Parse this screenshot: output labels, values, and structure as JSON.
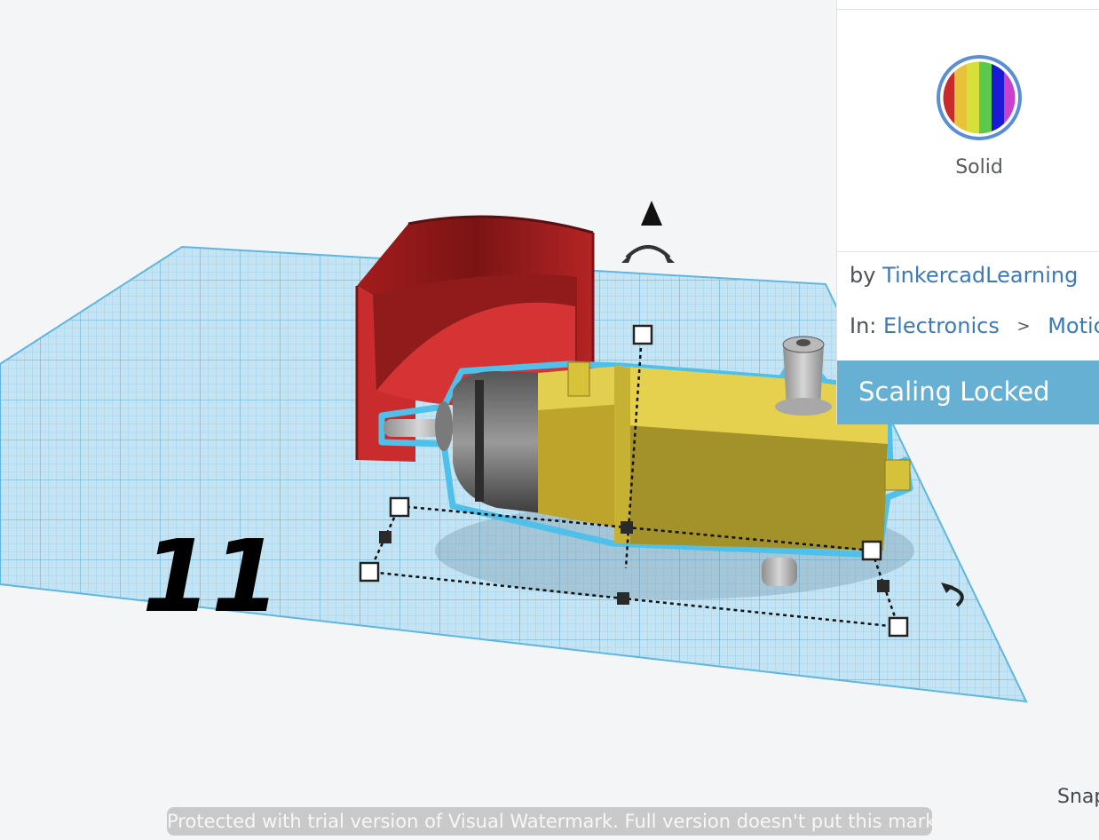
{
  "panel": {
    "material": {
      "label": "Solid",
      "swatch_colors": [
        "#c92a2a",
        "#e8c33a",
        "#d7e03a",
        "#5bc94b",
        "#1a1ad6",
        "#c940c9"
      ],
      "ring_color": "#5a8fd6"
    },
    "author": {
      "prefix": "by",
      "name": "TinkercadLearning"
    },
    "category": {
      "prefix": "In:",
      "items": [
        "Electronics",
        "Motic"
      ],
      "separator": ">"
    },
    "scaling_locked": "Scaling Locked"
  },
  "workspace": {
    "snap_label": "Snap",
    "icons": [
      "view-cube-arrow-icon",
      "rotate-arrow-icon",
      "rotate-handle-icon"
    ],
    "shape_number_label": "11"
  },
  "watermark": "Protected with trial version of Visual Watermark. Full version doesn't put this mark.",
  "colors": {
    "grid": "#8ccbea",
    "motor_body": "#d9c43b",
    "holder": "#c82c2c",
    "selection_outline": "#4fc0ea",
    "accent": "#65b0d3",
    "link": "#3d7ab5"
  }
}
